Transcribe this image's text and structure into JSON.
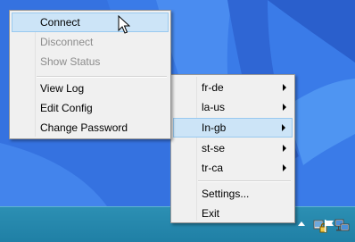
{
  "main_menu": {
    "items": [
      {
        "label": "Connect",
        "enabled": true,
        "highlighted": true
      },
      {
        "label": "Disconnect",
        "enabled": false
      },
      {
        "label": "Show Status",
        "enabled": false
      },
      {
        "label": "View Log",
        "enabled": true
      },
      {
        "label": "Edit Config",
        "enabled": true
      },
      {
        "label": "Change Password",
        "enabled": true
      }
    ]
  },
  "config_menu": {
    "items": [
      {
        "label": "fr-de",
        "has_submenu": true
      },
      {
        "label": "la-us",
        "has_submenu": true
      },
      {
        "label": "In-gb",
        "has_submenu": true,
        "highlighted": true
      },
      {
        "label": "st-se",
        "has_submenu": true
      },
      {
        "label": "tr-ca",
        "has_submenu": true
      },
      {
        "label": "Settings...",
        "has_submenu": false
      },
      {
        "label": "Exit",
        "has_submenu": false
      }
    ]
  },
  "taskbar": {
    "tray_icons": [
      "show-hidden-icons-chevron",
      "vpn-lock-icon",
      "action-center-flag-icon",
      "network-icon"
    ]
  },
  "colors": {
    "desktop": "#3a7be8",
    "taskbar": "#2188ad",
    "menu_background": "#f0f0f0",
    "highlight": "#cce4f7",
    "disabled_text": "#8c8c8c"
  }
}
